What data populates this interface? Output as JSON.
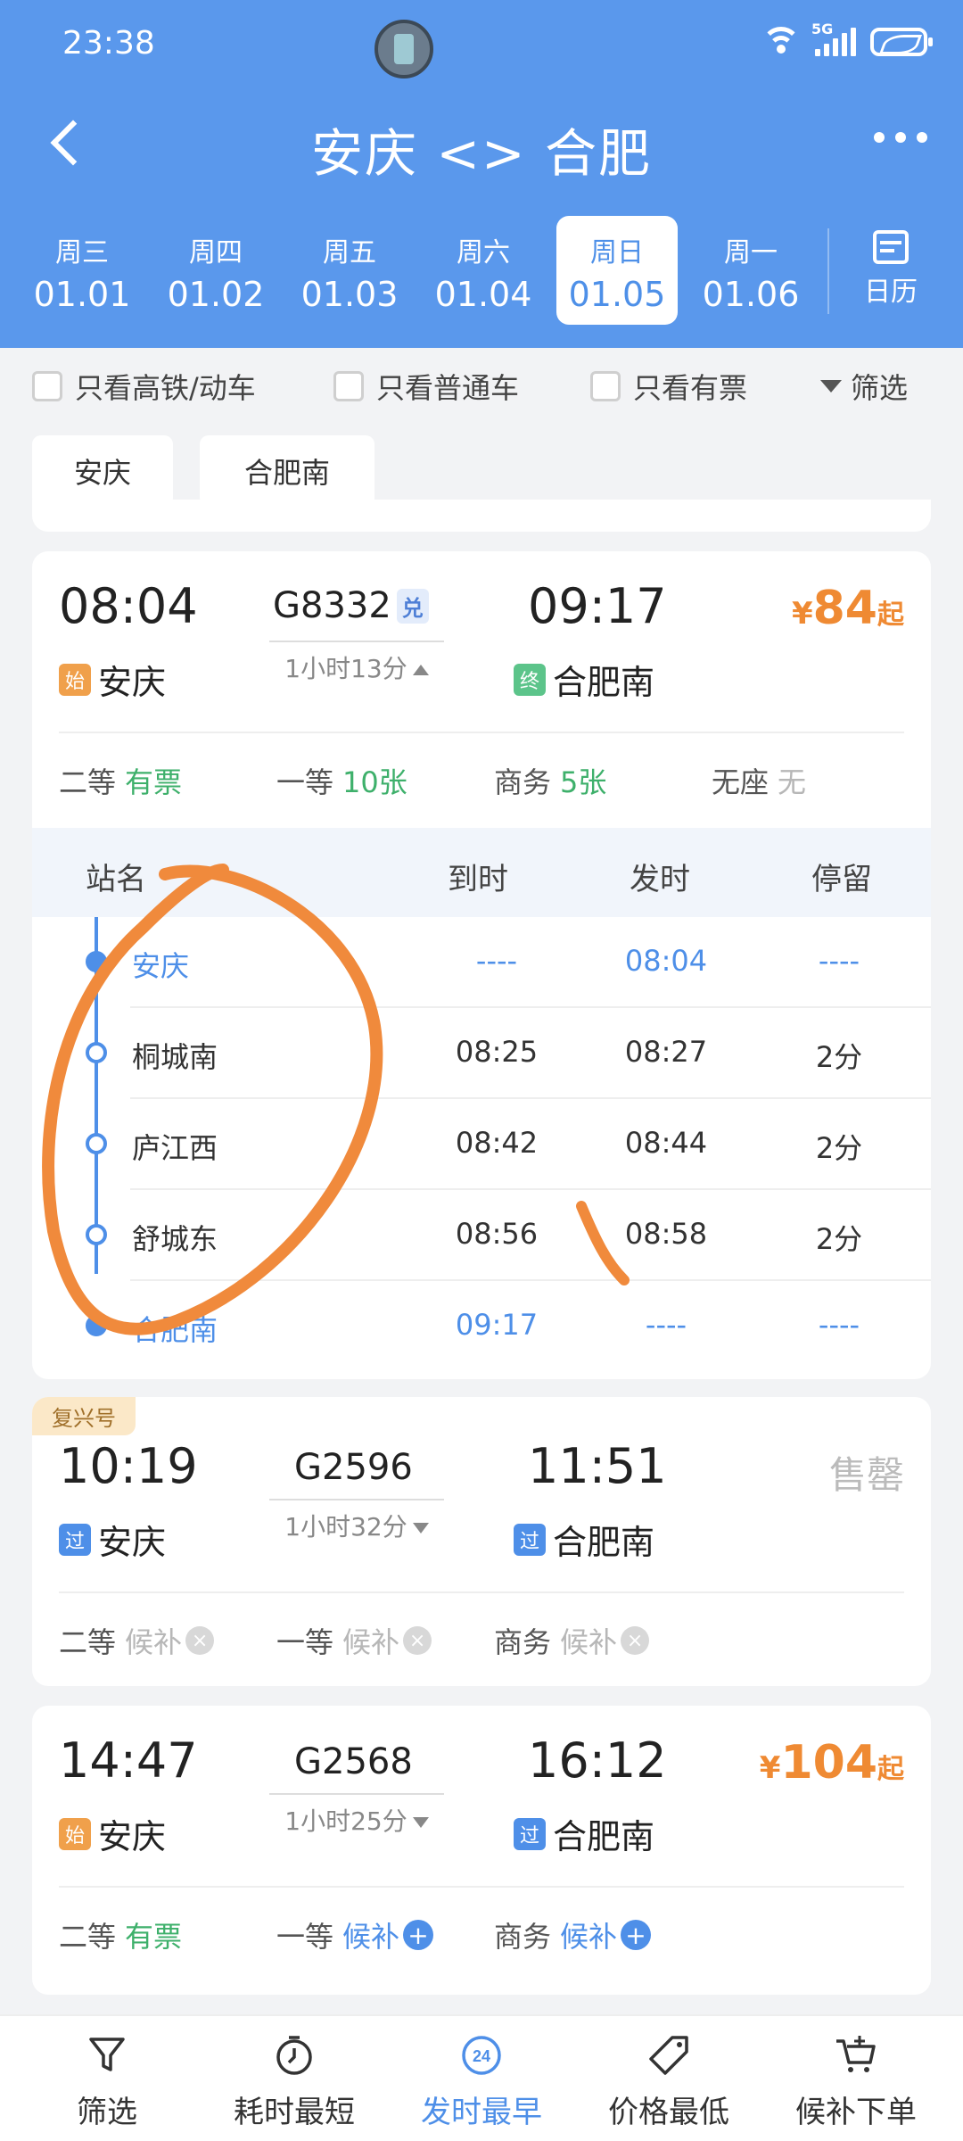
{
  "status_bar": {
    "time": "23:38",
    "network": "5G"
  },
  "header": {
    "title": "安庆 <> 合肥"
  },
  "dates": [
    {
      "weekday": "周三",
      "date": "01.01"
    },
    {
      "weekday": "周四",
      "date": "01.02"
    },
    {
      "weekday": "周五",
      "date": "01.03"
    },
    {
      "weekday": "周六",
      "date": "01.04"
    },
    {
      "weekday": "周日",
      "date": "01.05",
      "selected": true
    },
    {
      "weekday": "周一",
      "date": "01.06"
    }
  ],
  "calendar_label": "日历",
  "filters": {
    "high_speed": "只看高铁/动车",
    "normal": "只看普通车",
    "available": "只看有票",
    "filter": "筛选"
  },
  "station_chips": [
    "安庆",
    "合肥南"
  ],
  "trains": [
    {
      "depart_time": "08:04",
      "train_no": "G8332",
      "tag": "兑",
      "duration": "1小时13分",
      "arrive_time": "09:17",
      "from_badge": "始",
      "from_station": "安庆",
      "to_badge": "终",
      "to_station": "合肥南",
      "price_symbol": "¥",
      "price": "84",
      "price_suffix": "起",
      "seats": [
        {
          "class": "二等",
          "status": "有票"
        },
        {
          "class": "一等",
          "status": "10张"
        },
        {
          "class": "商务",
          "status": "5张"
        },
        {
          "class": "无座",
          "status": "无"
        }
      ],
      "stops_header": {
        "name": "站名",
        "arrive": "到时",
        "depart": "发时",
        "stay": "停留"
      },
      "stops": [
        {
          "name": "安庆",
          "arrive": "----",
          "depart": "08:04",
          "stay": "----"
        },
        {
          "name": "桐城南",
          "arrive": "08:25",
          "depart": "08:27",
          "stay": "2分"
        },
        {
          "name": "庐江西",
          "arrive": "08:42",
          "depart": "08:44",
          "stay": "2分"
        },
        {
          "name": "舒城东",
          "arrive": "08:56",
          "depart": "08:58",
          "stay": "2分"
        },
        {
          "name": "合肥南",
          "arrive": "09:17",
          "depart": "----",
          "stay": "----"
        }
      ]
    },
    {
      "label": "复兴号",
      "depart_time": "10:19",
      "train_no": "G2596",
      "duration": "1小时32分",
      "arrive_time": "11:51",
      "from_badge": "过",
      "from_station": "安庆",
      "to_badge": "过",
      "to_station": "合肥南",
      "status": "售罄",
      "seats": [
        {
          "class": "二等",
          "status": "候补"
        },
        {
          "class": "一等",
          "status": "候补"
        },
        {
          "class": "商务",
          "status": "候补"
        }
      ]
    },
    {
      "depart_time": "14:47",
      "train_no": "G2568",
      "duration": "1小时25分",
      "arrive_time": "16:12",
      "from_badge": "始",
      "from_station": "安庆",
      "to_badge": "过",
      "to_station": "合肥南",
      "price_symbol": "¥",
      "price": "104",
      "price_suffix": "起",
      "seats": [
        {
          "class": "二等",
          "status": "有票"
        },
        {
          "class": "一等",
          "status": "候补"
        },
        {
          "class": "商务",
          "status": "候补"
        }
      ]
    }
  ],
  "bottom_nav": [
    {
      "label": "筛选",
      "icon": "funnel-icon"
    },
    {
      "label": "耗时最短",
      "icon": "stopwatch-icon"
    },
    {
      "label": "发时最早",
      "icon": "24-clock-icon",
      "active": true,
      "icon_text": "24"
    },
    {
      "label": "价格最低",
      "icon": "price-tag-icon"
    },
    {
      "label": "候补下单",
      "icon": "cart-plus-icon"
    }
  ],
  "colors": {
    "header": "#5a98ec",
    "accent": "#4e8fe8",
    "price": "#ef8a33",
    "available": "#3eb06b",
    "annotation": "#f08a3c"
  }
}
